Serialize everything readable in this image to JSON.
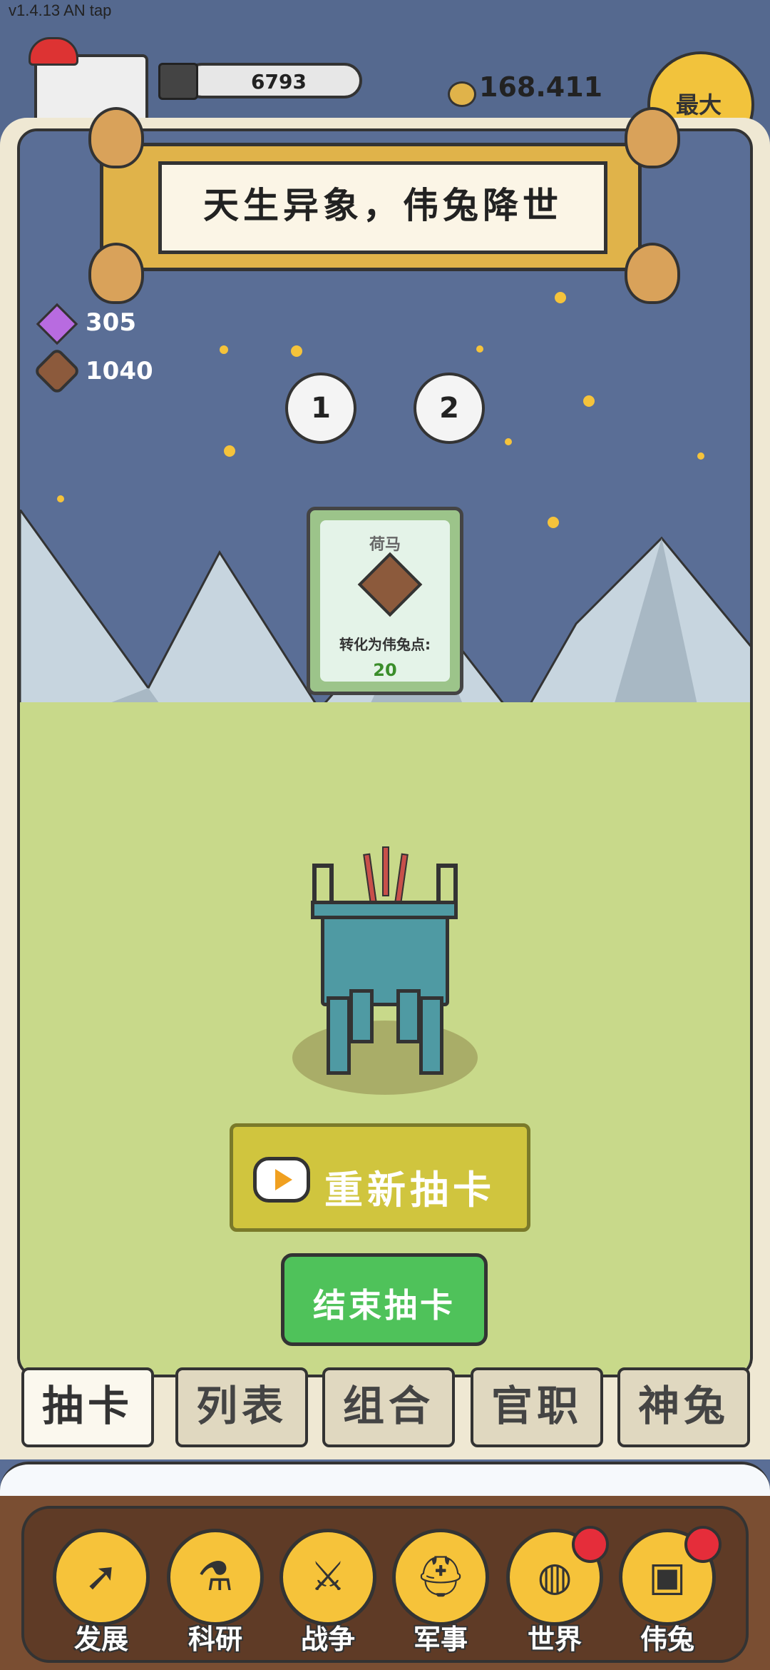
{
  "version": "v1.4.13 AN tap",
  "top": {
    "bars_amount": "6793",
    "coin_amount": "168.411",
    "max_button": "最大"
  },
  "title": "天生异象，伟兔降世",
  "resources": {
    "gems": "305",
    "chips": "1040"
  },
  "draw_rounds": [
    "1",
    "2"
  ],
  "card": {
    "name": "荷马",
    "caption": "转化为伟兔点:",
    "points": "20"
  },
  "buttons": {
    "redraw": "重新抽卡",
    "end": "结束抽卡"
  },
  "tabs": [
    {
      "label": "抽卡",
      "active": true
    },
    {
      "label": "列表",
      "active": false
    },
    {
      "label": "组合",
      "active": false
    },
    {
      "label": "官职",
      "active": false
    },
    {
      "label": "神兔",
      "active": false
    }
  ],
  "nav": [
    {
      "label": "发展",
      "icon": "arrow-up-icon",
      "glyph": "➚"
    },
    {
      "label": "科研",
      "icon": "flask-icon",
      "glyph": "⚗"
    },
    {
      "label": "战争",
      "icon": "swords-icon",
      "glyph": "⚔"
    },
    {
      "label": "军事",
      "icon": "helmet-icon",
      "glyph": "⛑"
    },
    {
      "label": "世界",
      "icon": "globe-icon",
      "glyph": "◍"
    },
    {
      "label": "伟兔",
      "icon": "rabbit-portrait-icon",
      "glyph": "▣"
    }
  ],
  "colors": {
    "sky": "#5a6e96",
    "grass": "#c8d98a",
    "accent_yellow": "#f6c33a",
    "end_button": "#4fc25a",
    "redraw_button": "#d0c53e",
    "badge_red": "#e52d3a"
  }
}
